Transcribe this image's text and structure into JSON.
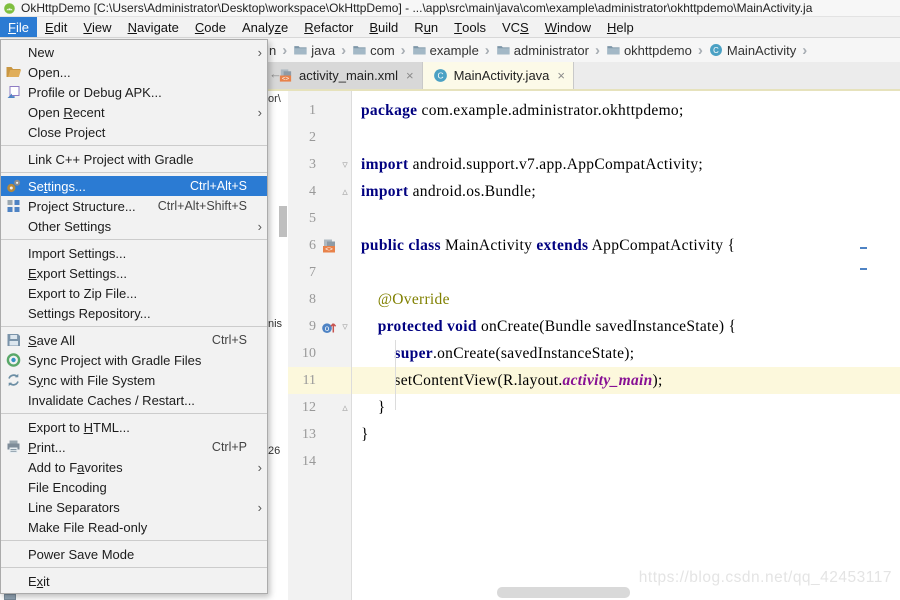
{
  "title_bar": {
    "title": "OkHttpDemo [C:\\Users\\Administrator\\Desktop\\workspace\\OkHttpDemo] - ...\\app\\src\\main\\java\\com\\example\\administrator\\okhttpdemo\\MainActivity.ja"
  },
  "menu_bar": {
    "items": [
      {
        "label": "File",
        "u": "F",
        "selected": true
      },
      {
        "label": "Edit",
        "u": "E"
      },
      {
        "label": "View",
        "u": "V"
      },
      {
        "label": "Navigate",
        "u": "N"
      },
      {
        "label": "Code",
        "u": "C"
      },
      {
        "label": "Analyze",
        "u": "z"
      },
      {
        "label": "Refactor",
        "u": "R"
      },
      {
        "label": "Build",
        "u": "B"
      },
      {
        "label": "Run",
        "u": "u"
      },
      {
        "label": "Tools",
        "u": "T"
      },
      {
        "label": "VCS",
        "u": "S"
      },
      {
        "label": "Window",
        "u": "W"
      },
      {
        "label": "Help",
        "u": "H"
      }
    ]
  },
  "file_menu": {
    "items": [
      {
        "label": "New",
        "submenu": true
      },
      {
        "label": "Open...",
        "icon": "open-folder"
      },
      {
        "label": "Profile or Debug APK...",
        "icon": "apk-profile"
      },
      {
        "label": "Open Recent",
        "u": "R",
        "submenu": true
      },
      {
        "label": "Close Project"
      },
      {
        "sep": true
      },
      {
        "label": "Link C++ Project with Gradle"
      },
      {
        "sep": true
      },
      {
        "label": "Settings...",
        "u": "t",
        "icon": "settings-gear",
        "shortcut": "Ctrl+Alt+S",
        "selected": true
      },
      {
        "label": "Project Structure...",
        "icon": "project-structure",
        "shortcut": "Ctrl+Alt+Shift+S"
      },
      {
        "label": "Other Settings",
        "submenu": true
      },
      {
        "sep": true
      },
      {
        "label": "Import Settings..."
      },
      {
        "label": "Export Settings...",
        "u": "E"
      },
      {
        "label": "Export to Zip File..."
      },
      {
        "label": "Settings Repository..."
      },
      {
        "sep": true
      },
      {
        "label": "Save All",
        "u": "S",
        "icon": "save-all",
        "shortcut": "Ctrl+S"
      },
      {
        "label": "Sync Project with Gradle Files",
        "icon": "gradle-sync"
      },
      {
        "label": "Sync with File System",
        "u": "y",
        "icon": "file-sync"
      },
      {
        "label": "Invalidate Caches / Restart..."
      },
      {
        "sep": true
      },
      {
        "label": "Export to HTML...",
        "u": "H"
      },
      {
        "label": "Print...",
        "u": "P",
        "icon": "print",
        "shortcut": "Ctrl+P"
      },
      {
        "label": "Add to Favorites",
        "u": "a",
        "submenu": true
      },
      {
        "label": "File Encoding"
      },
      {
        "label": "Line Separators",
        "submenu": true
      },
      {
        "label": "Make File Read-only"
      },
      {
        "sep": true
      },
      {
        "label": "Power Save Mode"
      },
      {
        "sep": true
      },
      {
        "label": "Exit",
        "u": "x"
      }
    ]
  },
  "breadcrumbs": {
    "left_fragment": "n",
    "items": [
      {
        "label": "java",
        "icon": "folder"
      },
      {
        "label": "com",
        "icon": "folder"
      },
      {
        "label": "example",
        "icon": "folder"
      },
      {
        "label": "administrator",
        "icon": "folder"
      },
      {
        "label": "okhttpdemo",
        "icon": "folder"
      },
      {
        "label": "MainActivity",
        "icon": "class"
      }
    ]
  },
  "tabs": {
    "left_fragment": "←",
    "items": [
      {
        "label": "activity_main.xml",
        "icon": "layout",
        "close": "×",
        "selected": false
      },
      {
        "label": "MainActivity.java",
        "icon": "class",
        "close": "×",
        "selected": true
      }
    ]
  },
  "editor": {
    "current_line": 11,
    "lines": [
      {
        "num": "1",
        "tokens": [
          [
            "package",
            "kw"
          ],
          [
            " com.example.administrator.okhttpdemo;",
            "pl"
          ]
        ]
      },
      {
        "num": "2",
        "tokens": []
      },
      {
        "num": "3",
        "fold": "down",
        "tokens": [
          [
            "import",
            "kw"
          ],
          [
            " android.support.v7.app.AppCompatActivity;",
            "pl"
          ]
        ]
      },
      {
        "num": "4",
        "fold": "up",
        "tokens": [
          [
            "import",
            "kw"
          ],
          [
            " android.os.Bundle;",
            "pl"
          ]
        ]
      },
      {
        "num": "5",
        "tokens": []
      },
      {
        "num": "6",
        "icon": "layout",
        "tokens": [
          [
            "public class",
            "kw"
          ],
          [
            " MainActivity ",
            "pl"
          ],
          [
            "extends",
            "kw"
          ],
          [
            " AppCompatActivity {",
            "pl"
          ]
        ]
      },
      {
        "num": "7",
        "tokens": []
      },
      {
        "num": "8",
        "tokens": [
          [
            "    ",
            "pl"
          ],
          [
            "@Override",
            "ann"
          ]
        ]
      },
      {
        "num": "9",
        "icon": "override",
        "fold": "down",
        "tokens": [
          [
            "    ",
            "pl"
          ],
          [
            "protected void",
            "kw"
          ],
          [
            " onCreate(Bundle savedInstanceState) {",
            "pl"
          ]
        ]
      },
      {
        "num": "10",
        "tokens": [
          [
            "        ",
            "pl"
          ],
          [
            "super",
            "kw"
          ],
          [
            ".onCreate(savedInstanceState);",
            "pl"
          ]
        ]
      },
      {
        "num": "11",
        "tokens": [
          [
            "        setContentView(R.layout.",
            "pl"
          ],
          [
            "activity_main",
            "res"
          ],
          [
            ");",
            "pl"
          ]
        ]
      },
      {
        "num": "12",
        "fold": "up",
        "tokens": [
          [
            "    }",
            "pl"
          ]
        ]
      },
      {
        "num": "13",
        "tokens": [
          [
            "}",
            "pl"
          ]
        ]
      },
      {
        "num": "14",
        "tokens": []
      }
    ]
  },
  "fragments": {
    "strip_top": "or\\",
    "strip_mid": "nis",
    "strip_bottom": "26"
  },
  "watermark": {
    "text": "https://blog.csdn.net/qq_42453117"
  },
  "colors": {
    "selection_blue": "#2b7bd3",
    "current_line_bg": "#fcf8dc",
    "keyword": "#000080",
    "annotation": "#808000",
    "resource_ref": "#871094"
  }
}
